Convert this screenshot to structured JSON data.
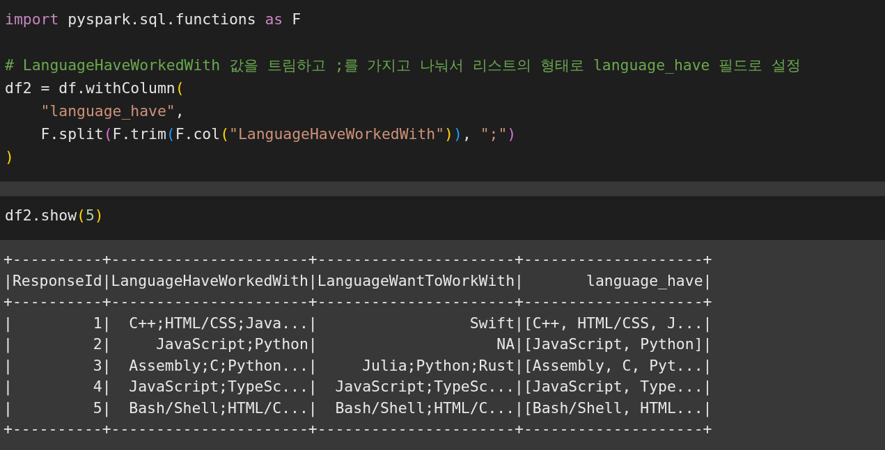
{
  "cells": [
    {
      "lines": [
        {
          "kind": "code",
          "tokens": [
            {
              "kind": "keyword",
              "text": "import"
            },
            {
              "kind": "plain",
              "text": " pyspark.sql.functions "
            },
            {
              "kind": "keyword",
              "text": "as"
            },
            {
              "kind": "plain",
              "text": " F"
            }
          ]
        },
        {
          "kind": "blank"
        },
        {
          "kind": "code",
          "tokens": [
            {
              "kind": "comment",
              "text": "# LanguageHaveWorkedWith 값을 트림하고 ;를 가지고 나눠서 리스트의 형태로 language_have 필드로 설정"
            }
          ]
        },
        {
          "kind": "code",
          "tokens": [
            {
              "kind": "plain",
              "text": "df2 = df.withColumn"
            },
            {
              "kind": "bracket1",
              "text": "("
            }
          ]
        },
        {
          "kind": "code",
          "indented": true,
          "tokens": [
            {
              "kind": "string",
              "text": "\"language_have\""
            },
            {
              "kind": "plain",
              "text": ","
            }
          ]
        },
        {
          "kind": "code",
          "indented": true,
          "tokens": [
            {
              "kind": "plain",
              "text": "F.split"
            },
            {
              "kind": "bracket2",
              "text": "("
            },
            {
              "kind": "plain",
              "text": "F.trim"
            },
            {
              "kind": "bracket3",
              "text": "("
            },
            {
              "kind": "plain",
              "text": "F.col"
            },
            {
              "kind": "bracket1",
              "text": "("
            },
            {
              "kind": "string",
              "text": "\"LanguageHaveWorkedWith\""
            },
            {
              "kind": "bracket1",
              "text": ")"
            },
            {
              "kind": "bracket3",
              "text": ")"
            },
            {
              "kind": "plain",
              "text": ", "
            },
            {
              "kind": "string",
              "text": "\";\""
            },
            {
              "kind": "bracket2",
              "text": ")"
            }
          ]
        },
        {
          "kind": "code",
          "tokens": [
            {
              "kind": "bracket1",
              "text": ")"
            }
          ]
        }
      ]
    },
    {
      "lines": [
        {
          "kind": "code",
          "tokens": [
            {
              "kind": "plain",
              "text": "df2.show"
            },
            {
              "kind": "bracket1",
              "text": "("
            },
            {
              "kind": "number",
              "text": "5"
            },
            {
              "kind": "bracket1",
              "text": ")"
            }
          ]
        }
      ],
      "output": [
        "+----------+----------------------+----------------------+--------------------+",
        "|ResponseId|LanguageHaveWorkedWith|LanguageWantToWorkWith|       language_have|",
        "+----------+----------------------+----------------------+--------------------+",
        "|         1|  C++;HTML/CSS;Java...|                 Swift|[C++, HTML/CSS, J...|",
        "|         2|     JavaScript;Python|                    NA|[JavaScript, Python]|",
        "|         3|  Assembly;C;Python...|     Julia;Python;Rust|[Assembly, C, Pyt...|",
        "|         4|  JavaScript;TypeSc...|  JavaScript;TypeSc...|[JavaScript, Type...|",
        "|         5|  Bash/Shell;HTML/C...|  Bash/Shell;HTML/C...|[Bash/Shell, HTML...|",
        "+----------+----------------------+----------------------+--------------------+"
      ]
    }
  ]
}
